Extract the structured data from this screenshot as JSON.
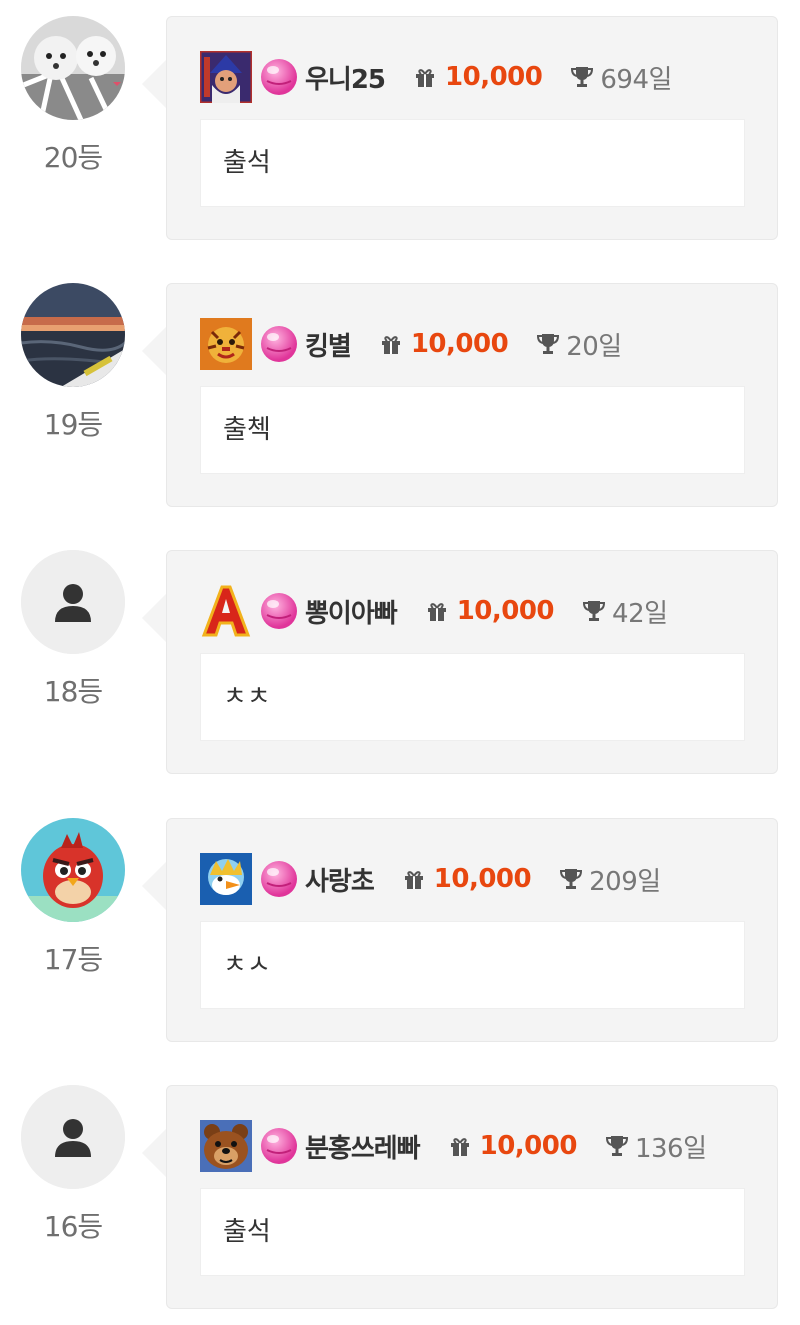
{
  "entries": [
    {
      "rank": "20등",
      "nickname": "우니25",
      "points": "10,000",
      "days": "694일",
      "message": "출석",
      "avatar": "dogs-photo",
      "game_icon": "wizard-game-icon"
    },
    {
      "rank": "19등",
      "nickname": "킹별",
      "points": "10,000",
      "days": "20일",
      "message": "출첵",
      "avatar": "sunset-sea-photo",
      "game_icon": "tiger-game-icon"
    },
    {
      "rank": "18등",
      "nickname": "뽕이아빠",
      "points": "10,000",
      "days": "42일",
      "message": "ㅊㅊ",
      "avatar": "default-person",
      "game_icon": "letter-a-game-icon"
    },
    {
      "rank": "17등",
      "nickname": "사랑초",
      "points": "10,000",
      "days": "209일",
      "message": "ㅊㅅ",
      "avatar": "red-bird-photo",
      "game_icon": "duck-game-icon"
    },
    {
      "rank": "16등",
      "nickname": "분홍쓰레빠",
      "points": "10,000",
      "days": "136일",
      "message": "출석",
      "avatar": "default-person",
      "game_icon": "bear-game-icon"
    }
  ],
  "colors": {
    "points": "#e8470f",
    "card_bg": "#f4f4f4",
    "avatar_default_bg": "#eeeeee"
  },
  "icons": {
    "gift": "gift-icon",
    "trophy": "trophy-icon",
    "candy": "pink-candy-icon"
  }
}
